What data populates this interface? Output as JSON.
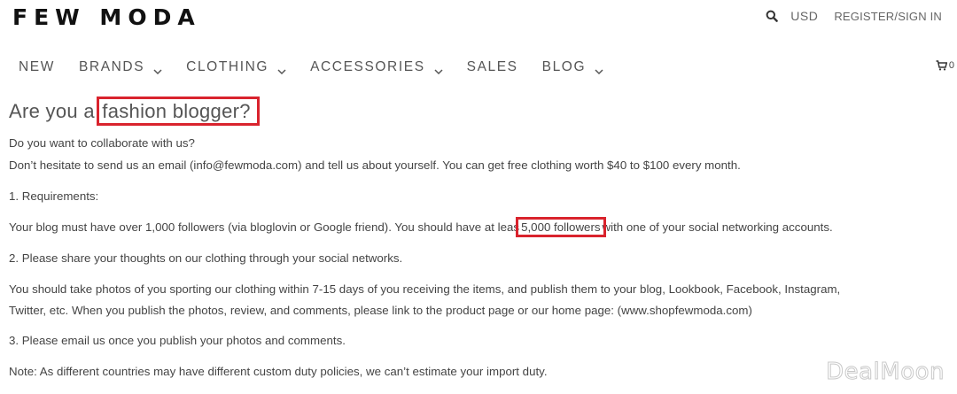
{
  "header": {
    "logo": "FEW MODA",
    "search_icon": "search-icon",
    "currency": "USD",
    "account_link": "REGISTER/SIGN IN"
  },
  "nav": {
    "items": [
      {
        "label": "NEW",
        "has_dropdown": false
      },
      {
        "label": "BRANDS",
        "has_dropdown": true
      },
      {
        "label": "CLOTHING",
        "has_dropdown": true
      },
      {
        "label": "ACCESSORIES",
        "has_dropdown": true
      },
      {
        "label": "SALES",
        "has_dropdown": false
      },
      {
        "label": "BLOG",
        "has_dropdown": true
      }
    ],
    "cart_icon": "cart-icon",
    "cart_count": "0"
  },
  "content": {
    "heading_prefix": "Are you a ",
    "heading_highlight": "fashion blogger?",
    "line1": "Do you want to collaborate with us?",
    "line2": "Don’t hesitate to send us an email (info@fewmoda.com) and tell us about yourself. You can get free clothing worth $40 to $100 every month.",
    "req_title": "1. Requirements:",
    "req_text_before": "Your blog must have over 1,000 followers (via bloglovin or Google friend). You should have at leas",
    "req_highlight": "5,000 followers",
    "req_text_after": "with one of your social networking accounts.",
    "item2": "2. Please share your thoughts on our clothing through your social networks.",
    "photos_line1": "You should take photos of you sporting our clothing within 7-15 days of you receiving the items, and publish them to your blog, Lookbook, Facebook, Instagram,",
    "photos_line2": "Twitter, etc. When you publish the photos, review, and comments, please link to the product page or our home page: (www.shopfewmoda.com)",
    "item3": "3. Please email us once you publish your photos and comments.",
    "note": "Note: As different countries may have different custom duty policies, we can’t estimate your import duty."
  },
  "watermark": "DealMoon",
  "colors": {
    "highlight_box": "#d9232d",
    "text": "#444444",
    "logo": "#111111"
  }
}
